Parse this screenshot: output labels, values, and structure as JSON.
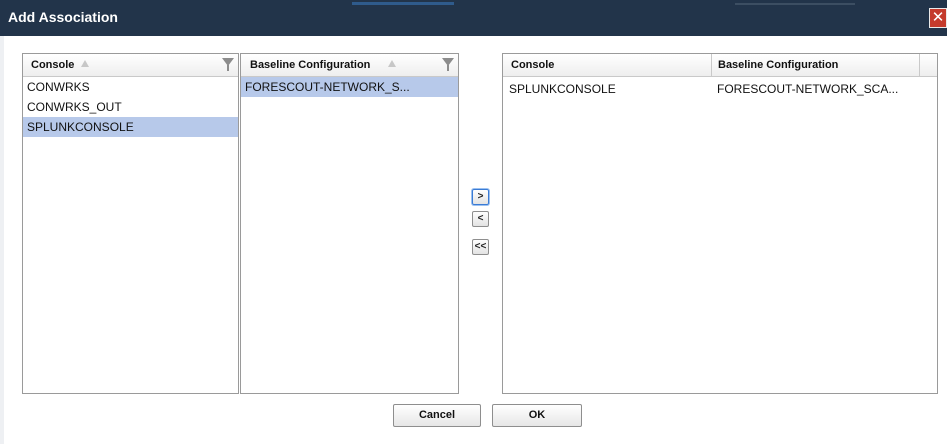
{
  "dialog": {
    "title": "Add Association",
    "close_glyph": "✕"
  },
  "console_panel": {
    "header": "Console",
    "rows": [
      "CONWRKS",
      "CONWRKS_OUT",
      "SPLUNKCONSOLE"
    ],
    "selected_index": 2
  },
  "baseline_panel": {
    "header": "Baseline Configuration",
    "rows": [
      "FORESCOUT-NETWORK_S..."
    ],
    "selected_index": 0
  },
  "association_panel": {
    "headers": [
      "Console",
      "Baseline Configuration"
    ],
    "rows": [
      [
        "SPLUNKCONSOLE",
        "FORESCOUT-NETWORK_SCA..."
      ]
    ]
  },
  "transfer_buttons": {
    "add": ">",
    "remove": "<",
    "remove_all": "<<"
  },
  "footer": {
    "cancel": "Cancel",
    "ok": "OK"
  },
  "colors": {
    "titlebar": "#22344a",
    "selection": "#b7c9ea",
    "close": "#c43a2c"
  }
}
